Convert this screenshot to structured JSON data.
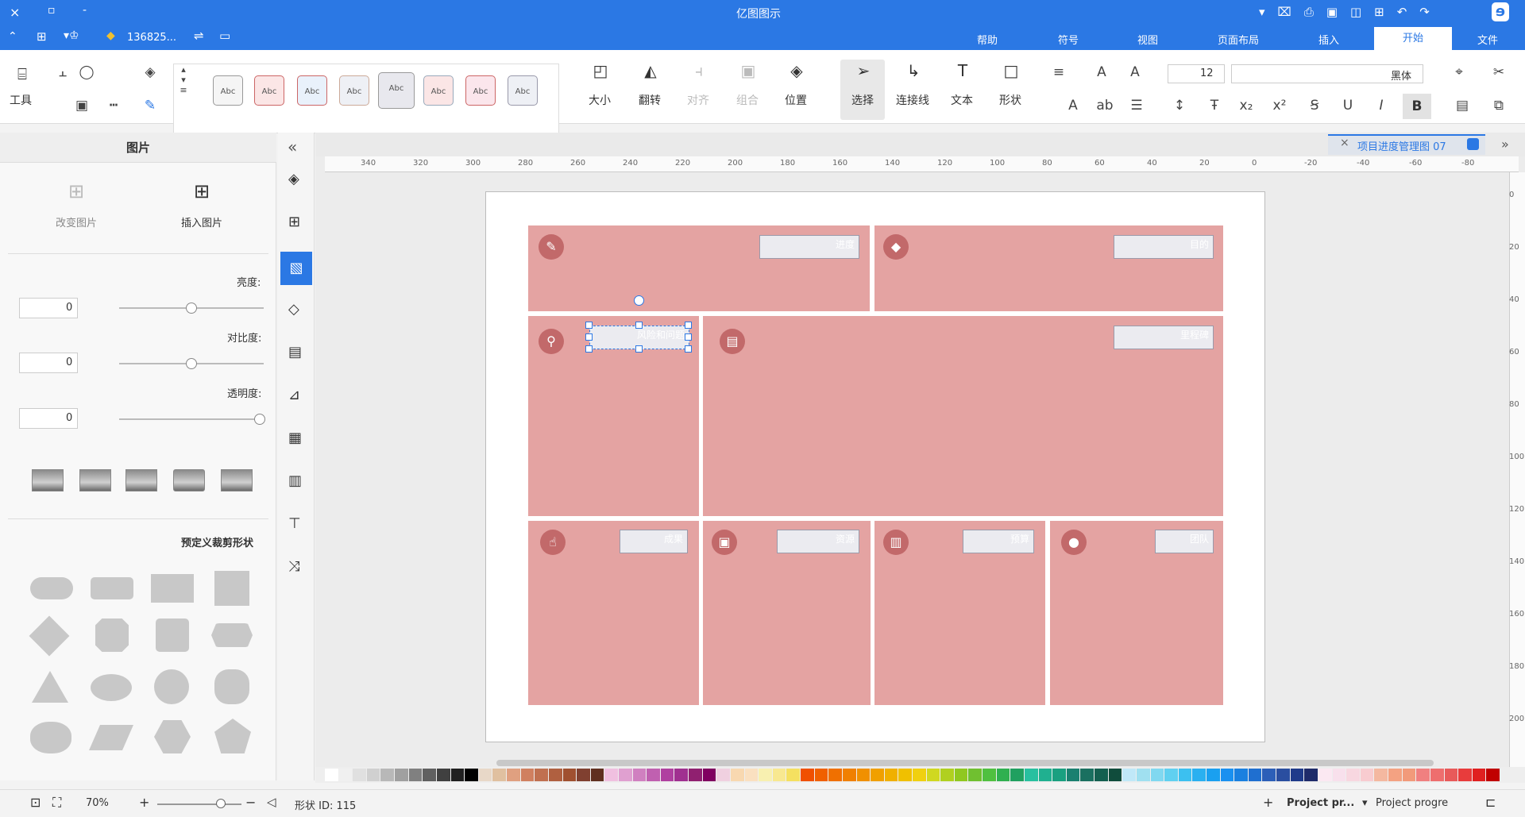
{
  "window": {
    "title": "亿图图示",
    "close": "×",
    "restore": "▫",
    "minimize": "‑"
  },
  "menubar": {
    "tabs": [
      "文件",
      "开始",
      "插入",
      "页面布局",
      "视图",
      "符号",
      "帮助"
    ],
    "active": "开始",
    "user": "136825...",
    "theme": "风格"
  },
  "ribbon": {
    "font_name": "黑体",
    "font_size": "12",
    "tools_label": "工具",
    "groups": {
      "shape": "形状",
      "text": "文本",
      "connector": "连接线",
      "select": "选择",
      "position": "位置",
      "group": "组合",
      "align": "对齐",
      "flip": "翻转",
      "size": "大小"
    },
    "style_sample": "Abc",
    "style_colors": [
      "#f5f5f5",
      "#fbe6e6",
      "#e9f1fb",
      "#eef0f5",
      "#fbf2dc",
      "#fbe6e6",
      "#fbe6ec",
      "#eef0f5"
    ]
  },
  "left_panel": {
    "title": "图片",
    "insert_image": "插入图片",
    "change_image": "改变图片",
    "brightness_label": "亮度:",
    "brightness_value": "0",
    "contrast_label": "对比度:",
    "contrast_value": "0",
    "transparency_label": "透明度:",
    "transparency_value": "0",
    "crop_section": "预定义裁剪形状"
  },
  "doc_tab": {
    "name": "项目进度管理图 07",
    "close": "×"
  },
  "ruler": {
    "h_ticks": [
      "-80",
      "-60",
      "-40",
      "-20",
      "0",
      "20",
      "40",
      "60",
      "80",
      "100",
      "120",
      "140",
      "160",
      "180",
      "200",
      "220",
      "240",
      "260",
      "280",
      "300",
      "320",
      "340"
    ],
    "v_ticks": [
      "0",
      "20",
      "40",
      "60",
      "80",
      "100",
      "120",
      "140",
      "160",
      "180",
      "200"
    ]
  },
  "diagram": {
    "labels": {
      "top_left": "目的",
      "top_right": "进度",
      "mid_left": "里程碑",
      "mid_right": "风险和问题",
      "bot_1": "团队",
      "bot_2": "预算",
      "bot_3": "资源",
      "bot_4": "成果"
    },
    "fill_color": "#e4a3a2",
    "icon_color": "#c2696a"
  },
  "status": {
    "page_label": "Project progre",
    "page_tab": "Project pr...",
    "add_page": "+",
    "shape_id": "形状 ID: 115",
    "zoom": "70%"
  },
  "palette": [
    "#c00000",
    "#e02020",
    "#e83c3c",
    "#e85a5a",
    "#ee6e6e",
    "#f08080",
    "#f29a7a",
    "#f4a282",
    "#f4b8a0",
    "#f8ccd0",
    "#f8d7e0",
    "#f8e0ec",
    "#fbe8f2",
    "#1f2b6a",
    "#1f3a8a",
    "#2a4ea0",
    "#2c5fb8",
    "#1f6fd0",
    "#1a80e0",
    "#1a90f0",
    "#1aa0f0",
    "#2ab0f0",
    "#3cc0f0",
    "#60d0f0",
    "#80d8f0",
    "#a0e0f0",
    "#c0e8f8",
    "#104c3c",
    "#146050",
    "#1a7060",
    "#1a8070",
    "#1aa080",
    "#20b090",
    "#28c0a0",
    "#20a060",
    "#30b050",
    "#50c040",
    "#70c030",
    "#90c820",
    "#b0d020",
    "#d0d820",
    "#f0d010",
    "#f0c000",
    "#f0b000",
    "#f0a000",
    "#f09000",
    "#f08000",
    "#f07000",
    "#f06000",
    "#f05000",
    "#f5e060",
    "#f8e890",
    "#f8f0b0",
    "#fae0c0",
    "#f8d8b0",
    "#f0d0e0",
    "#800060",
    "#902070",
    "#a03090",
    "#b040a0",
    "#c060b0",
    "#d080c0",
    "#e0a0d0",
    "#f0c0e0",
    "#603020",
    "#804030",
    "#a05030",
    "#b06040",
    "#c07050",
    "#d08060",
    "#e0a080",
    "#e0c0a0",
    "#e8d8c8",
    "#000000",
    "#202020",
    "#404040",
    "#606060",
    "#808080",
    "#a0a0a0",
    "#b8b8b8",
    "#d0d0d0",
    "#e0e0e0",
    "#f0f0f0",
    "#ffffff"
  ]
}
